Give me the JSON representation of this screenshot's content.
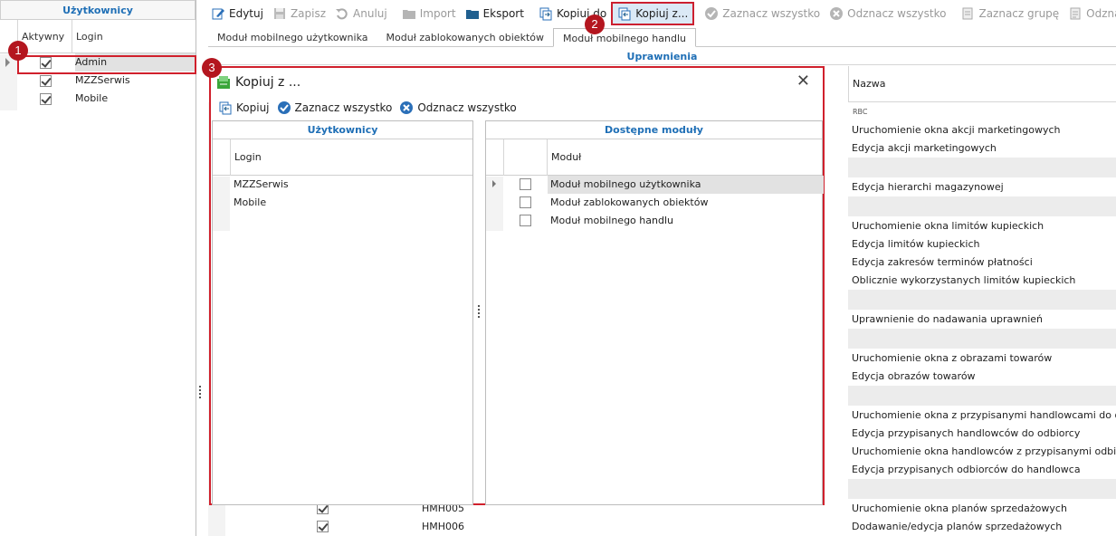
{
  "users_panel": {
    "title": "Użytkownicy",
    "columns": [
      "Aktywny",
      "Login"
    ],
    "rows": [
      {
        "active": true,
        "login": "Admin",
        "selected": true
      },
      {
        "active": true,
        "login": "MZZSerwis",
        "selected": false
      },
      {
        "active": true,
        "login": "Mobile",
        "selected": false
      }
    ]
  },
  "toolbar": {
    "edit": "Edytuj",
    "save": "Zapisz",
    "cancel": "Anuluj",
    "import": "Import",
    "export": "Eksport",
    "copy_to": "Kopiuj do",
    "copy_from": "Kopiuj z...",
    "select_all": "Zaznacz wszystko",
    "deselect_all": "Odznacz wszystko",
    "select_group": "Zaznacz grupę",
    "deselect_group": "Odznacz grupę"
  },
  "tabs": [
    {
      "label": "Moduł mobilnego użytkownika",
      "active": false
    },
    {
      "label": "Moduł zablokowanych obiektów",
      "active": false
    },
    {
      "label": "Moduł mobilnego handlu",
      "active": true
    }
  ],
  "permissions": {
    "group_header": "Uprawnienia",
    "column_name": "Nazwa",
    "filter_icon_text": "RBC",
    "rows": [
      "Uruchomienie okna akcji marketingowych",
      "Edycja akcji marketingowych",
      "Edycja hierarchi magazynowej",
      "Uruchomienie okna limitów kupieckich",
      "Edycja limitów kupieckich",
      "Edycja zakresów terminów płatności",
      "Oblicznie wykorzystanych limitów kupieckich",
      "Uprawnienie do nadawania uprawnień",
      "Uruchomienie okna z obrazami towarów",
      "Edycja obrazów towarów",
      "Uruchomienie okna z przypisanymi handlowcami do odbiorcy",
      "Edycja przypisanych handlowców do odbiorcy",
      "Uruchomienie okna handlowców z przypisanymi odbiorcami",
      "Edycja przypisanych odbiorców do handlowca",
      "Uruchomienie okna planów sprzedażowych",
      "Dodawanie/edycja planów sprzedażowych"
    ],
    "bottom_codes": [
      "HMH005",
      "HMH006"
    ]
  },
  "dialog": {
    "title": "Kopiuj z ...",
    "toolbar": {
      "copy": "Kopiuj",
      "select_all": "Zaznacz wszystko",
      "deselect_all": "Odznacz wszystko"
    },
    "users_pane": {
      "title": "Użytkownicy",
      "column": "Login",
      "rows": [
        "MZZSerwis",
        "Mobile"
      ]
    },
    "modules_pane": {
      "title": "Dostępne moduły",
      "column": "Moduł",
      "rows": [
        {
          "label": "Moduł mobilnego użytkownika",
          "checked": false,
          "selected": true
        },
        {
          "label": "Moduł zablokowanych obiektów",
          "checked": false,
          "selected": false
        },
        {
          "label": "Moduł mobilnego handlu",
          "checked": false,
          "selected": false
        }
      ]
    }
  },
  "markers": [
    "1",
    "2",
    "3"
  ],
  "colors": {
    "accent_blue": "#1f6fb6",
    "callout_red": "#b4161f",
    "highlight_border": "#d0202c"
  }
}
